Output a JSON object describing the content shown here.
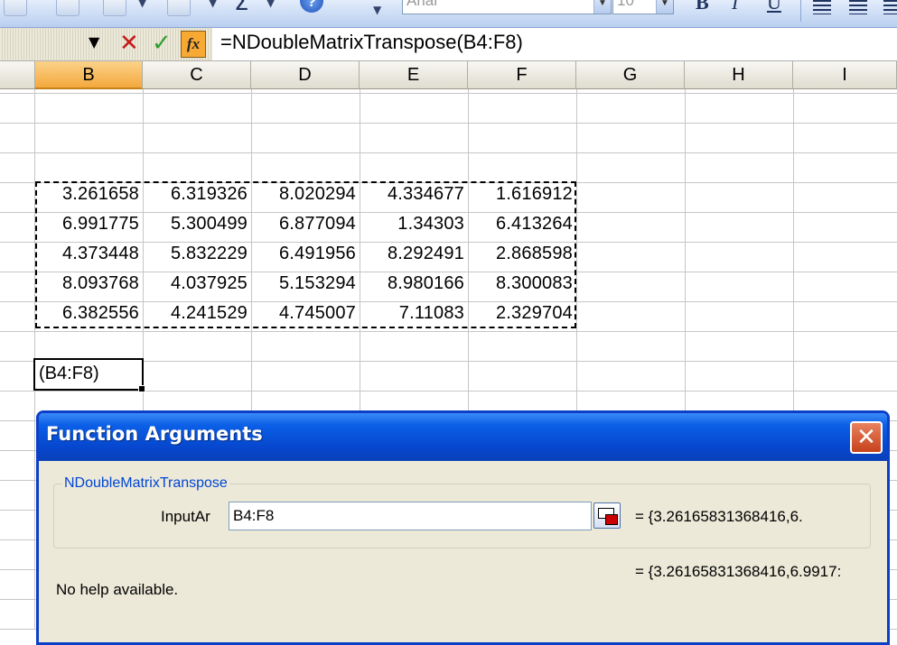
{
  "toolbar": {
    "font_name": "Arial",
    "font_size": "10",
    "bold_label": "B",
    "italic_label": "I",
    "underline_label": "U",
    "sigma_label": "Σ",
    "help_label": "?"
  },
  "formula_bar": {
    "formula": "=NDoubleMatrixTranspose(B4:F8)",
    "cancel_icon": "✕",
    "enter_icon": "✓",
    "fx_label": "fx"
  },
  "columns": [
    "B",
    "C",
    "D",
    "E",
    "F",
    "G",
    "H",
    "I"
  ],
  "selected_column": "B",
  "matrix": [
    [
      "3.261658",
      "6.319326",
      "8.020294",
      "4.334677",
      "1.616912"
    ],
    [
      "6.991775",
      "5.300499",
      "6.877094",
      "1.34303",
      "6.413264"
    ],
    [
      "4.373448",
      "5.832229",
      "6.491956",
      "8.292491",
      "2.868598"
    ],
    [
      "8.093768",
      "4.037925",
      "5.153294",
      "8.980166",
      "8.300083"
    ],
    [
      "6.382556",
      "4.241529",
      "4.745007",
      "7.11083",
      "2.329704"
    ]
  ],
  "edit_cell_text": "(B4:F8)",
  "dialog": {
    "title": "Function Arguments",
    "close_icon": "✕",
    "function_name": "NDoubleMatrixTranspose",
    "arg_label": "InputAr",
    "arg_value": "B4:F8",
    "arg_result": "=  {3.26165831368416,6.",
    "formula_result": "=  {3.26165831368416,6.9917:",
    "help_text": "No help available."
  }
}
